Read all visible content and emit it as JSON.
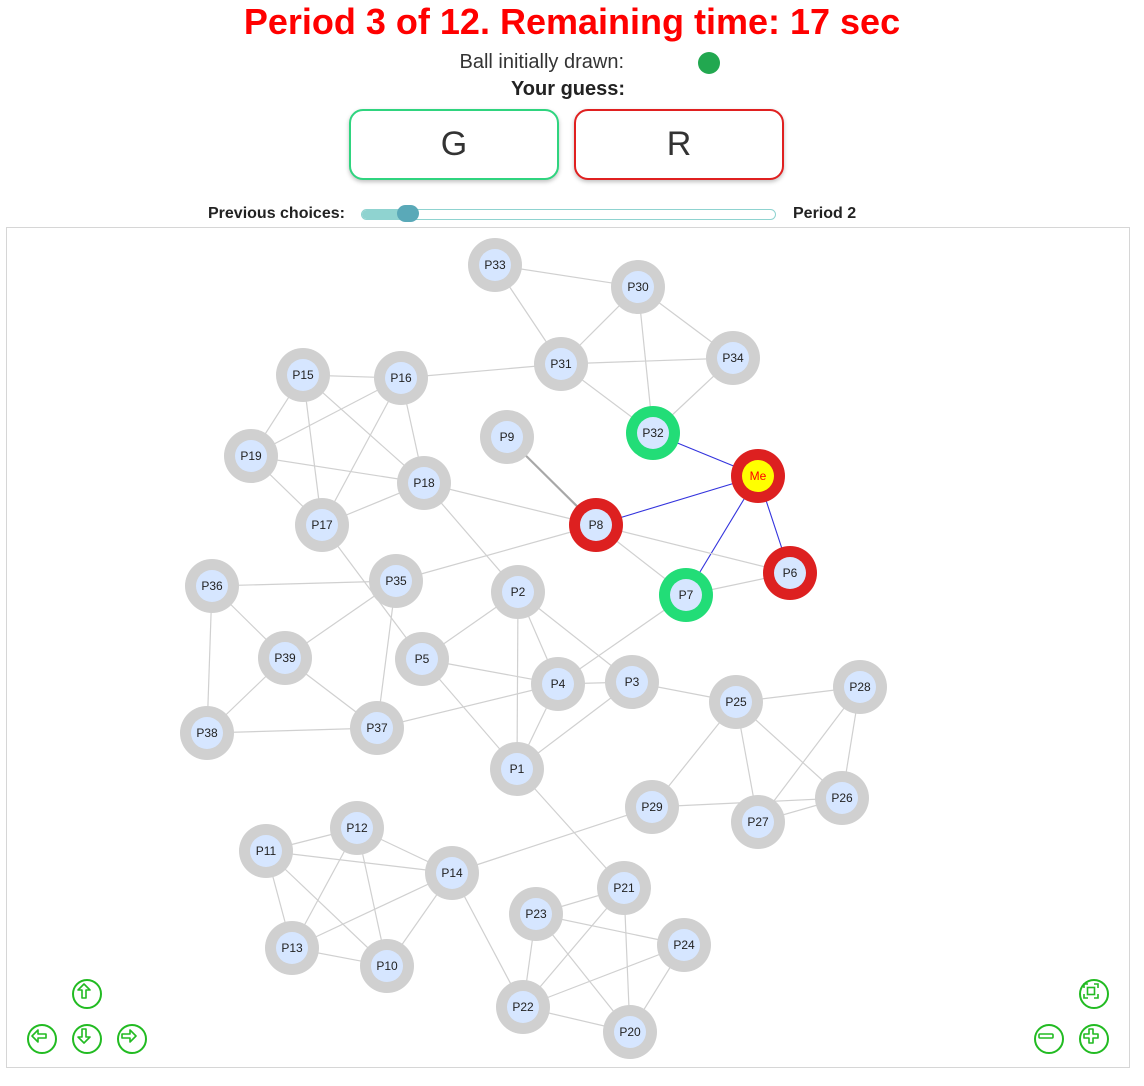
{
  "header": {
    "title": "Period 3 of 12. Remaining time: 17 sec",
    "ball_label": "Ball initially drawn:",
    "ball_color": "#22a850",
    "guess_label": "Your guess:"
  },
  "buttons": {
    "green_label": "G",
    "red_label": "R"
  },
  "slider": {
    "label": "Previous choices:",
    "period_label": "Period 2",
    "value_fraction": 0.1
  },
  "colors": {
    "green": "#22dd77",
    "red": "#dd2020",
    "grey": "#d0d0d0",
    "node_fill": "#d6e6ff",
    "me_fill": "#ffff00",
    "me_text": "#ff0000",
    "edge": "#d0d0d0",
    "me_edge": "#3333dd"
  },
  "graph": {
    "nodes": [
      {
        "id": "Me",
        "status": "red",
        "me": true
      },
      {
        "id": "P1",
        "status": "grey"
      },
      {
        "id": "P2",
        "status": "grey"
      },
      {
        "id": "P3",
        "status": "grey"
      },
      {
        "id": "P4",
        "status": "grey"
      },
      {
        "id": "P5",
        "status": "grey"
      },
      {
        "id": "P6",
        "status": "red"
      },
      {
        "id": "P7",
        "status": "green"
      },
      {
        "id": "P8",
        "status": "red"
      },
      {
        "id": "P9",
        "status": "grey"
      },
      {
        "id": "P10",
        "status": "grey"
      },
      {
        "id": "P11",
        "status": "grey"
      },
      {
        "id": "P12",
        "status": "grey"
      },
      {
        "id": "P13",
        "status": "grey"
      },
      {
        "id": "P14",
        "status": "grey"
      },
      {
        "id": "P15",
        "status": "grey"
      },
      {
        "id": "P16",
        "status": "grey"
      },
      {
        "id": "P17",
        "status": "grey"
      },
      {
        "id": "P18",
        "status": "grey"
      },
      {
        "id": "P19",
        "status": "grey"
      },
      {
        "id": "P20",
        "status": "grey"
      },
      {
        "id": "P21",
        "status": "grey"
      },
      {
        "id": "P22",
        "status": "grey"
      },
      {
        "id": "P23",
        "status": "grey"
      },
      {
        "id": "P24",
        "status": "grey"
      },
      {
        "id": "P25",
        "status": "grey"
      },
      {
        "id": "P26",
        "status": "grey"
      },
      {
        "id": "P27",
        "status": "grey"
      },
      {
        "id": "P28",
        "status": "grey"
      },
      {
        "id": "P29",
        "status": "grey"
      },
      {
        "id": "P30",
        "status": "grey"
      },
      {
        "id": "P31",
        "status": "grey"
      },
      {
        "id": "P32",
        "status": "green"
      },
      {
        "id": "P33",
        "status": "grey"
      },
      {
        "id": "P34",
        "status": "grey"
      },
      {
        "id": "P35",
        "status": "grey"
      },
      {
        "id": "P36",
        "status": "grey"
      },
      {
        "id": "P37",
        "status": "grey"
      },
      {
        "id": "P38",
        "status": "grey"
      },
      {
        "id": "P39",
        "status": "grey"
      }
    ],
    "edges": [
      [
        "P33",
        "P30"
      ],
      [
        "P33",
        "P31"
      ],
      [
        "P30",
        "P31"
      ],
      [
        "P30",
        "P34"
      ],
      [
        "P30",
        "P32"
      ],
      [
        "P31",
        "P34"
      ],
      [
        "P31",
        "P32"
      ],
      [
        "P31",
        "P16"
      ],
      [
        "P32",
        "P34"
      ],
      [
        "P32",
        "Me"
      ],
      [
        "Me",
        "P8"
      ],
      [
        "Me",
        "P7"
      ],
      [
        "Me",
        "P6"
      ],
      [
        "P9",
        "P8"
      ],
      [
        "P8",
        "P18"
      ],
      [
        "P8",
        "P35"
      ],
      [
        "P8",
        "P7"
      ],
      [
        "P8",
        "P6"
      ],
      [
        "P7",
        "P6"
      ],
      [
        "P7",
        "P4"
      ],
      [
        "P15",
        "P16"
      ],
      [
        "P15",
        "P19"
      ],
      [
        "P15",
        "P17"
      ],
      [
        "P15",
        "P18"
      ],
      [
        "P16",
        "P19"
      ],
      [
        "P16",
        "P17"
      ],
      [
        "P16",
        "P18"
      ],
      [
        "P19",
        "P18"
      ],
      [
        "P19",
        "P17"
      ],
      [
        "P17",
        "P18"
      ],
      [
        "P17",
        "P5"
      ],
      [
        "P18",
        "P2"
      ],
      [
        "P36",
        "P35"
      ],
      [
        "P36",
        "P38"
      ],
      [
        "P36",
        "P39"
      ],
      [
        "P35",
        "P39"
      ],
      [
        "P35",
        "P37"
      ],
      [
        "P39",
        "P38"
      ],
      [
        "P39",
        "P37"
      ],
      [
        "P38",
        "P37"
      ],
      [
        "P37",
        "P4"
      ],
      [
        "P2",
        "P5"
      ],
      [
        "P2",
        "P4"
      ],
      [
        "P2",
        "P3"
      ],
      [
        "P2",
        "P1"
      ],
      [
        "P5",
        "P4"
      ],
      [
        "P5",
        "P1"
      ],
      [
        "P4",
        "P3"
      ],
      [
        "P4",
        "P1"
      ],
      [
        "P3",
        "P1"
      ],
      [
        "P3",
        "P25"
      ],
      [
        "P25",
        "P28"
      ],
      [
        "P25",
        "P29"
      ],
      [
        "P25",
        "P27"
      ],
      [
        "P25",
        "P26"
      ],
      [
        "P28",
        "P27"
      ],
      [
        "P28",
        "P26"
      ],
      [
        "P29",
        "P26"
      ],
      [
        "P27",
        "P26"
      ],
      [
        "P29",
        "P14"
      ],
      [
        "P1",
        "P21"
      ],
      [
        "P11",
        "P12"
      ],
      [
        "P11",
        "P14"
      ],
      [
        "P11",
        "P13"
      ],
      [
        "P11",
        "P10"
      ],
      [
        "P12",
        "P14"
      ],
      [
        "P12",
        "P13"
      ],
      [
        "P12",
        "P10"
      ],
      [
        "P14",
        "P13"
      ],
      [
        "P14",
        "P10"
      ],
      [
        "P13",
        "P10"
      ],
      [
        "P14",
        "P22"
      ],
      [
        "P21",
        "P23"
      ],
      [
        "P21",
        "P22"
      ],
      [
        "P21",
        "P20"
      ],
      [
        "P23",
        "P22"
      ],
      [
        "P23",
        "P20"
      ],
      [
        "P23",
        "P24"
      ],
      [
        "P22",
        "P24"
      ],
      [
        "P22",
        "P20"
      ],
      [
        "P24",
        "P20"
      ]
    ]
  },
  "controls": {
    "up_icon": "arrow-up-icon",
    "left_icon": "arrow-left-icon",
    "down_icon": "arrow-down-icon",
    "right_icon": "arrow-right-icon",
    "fit_icon": "fit-screen-icon",
    "zoom_out_icon": "zoom-out-icon",
    "zoom_in_icon": "zoom-in-icon"
  }
}
